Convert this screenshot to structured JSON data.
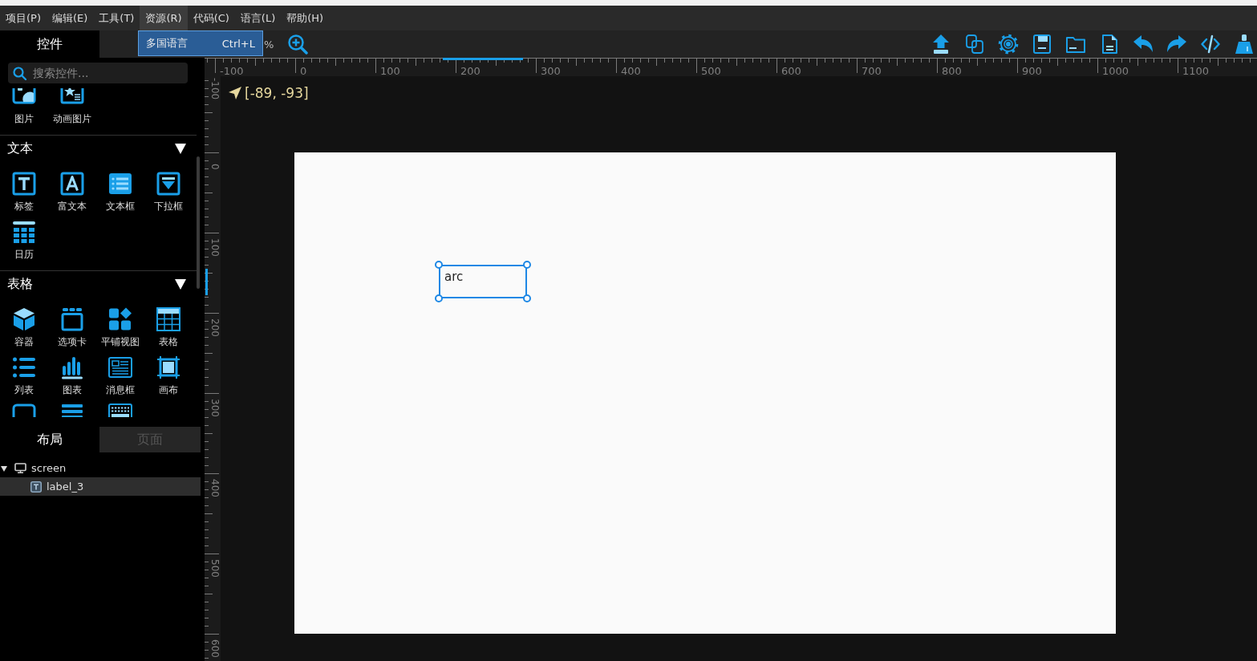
{
  "menu_bar": {
    "items": [
      {
        "label": "项目(P)",
        "selected": false
      },
      {
        "label": "编辑(E)",
        "selected": false
      },
      {
        "label": "工具(T)",
        "selected": false
      },
      {
        "label": "资源(R)",
        "selected": true
      },
      {
        "label": "代码(C)",
        "selected": false
      },
      {
        "label": "语言(L)",
        "selected": false
      },
      {
        "label": "帮助(H)",
        "selected": false
      }
    ]
  },
  "menu_dropdown": {
    "items": [
      {
        "label": "多国语言",
        "shortcut": "Ctrl+L",
        "selected": true
      }
    ]
  },
  "left_panel": {
    "top_tabs": [
      {
        "label": "控件",
        "selected": true
      }
    ],
    "search": {
      "placeholder": "搜索控件..."
    },
    "widget_groups": [
      {
        "items": [
          {
            "kind": "image",
            "label": "图片"
          },
          {
            "kind": "animimg",
            "label": "动画图片"
          }
        ]
      },
      {
        "title": "文本",
        "expanded": true,
        "items": [
          {
            "kind": "label",
            "label": "标签"
          },
          {
            "kind": "richtext",
            "label": "富文本"
          },
          {
            "kind": "textarea",
            "label": "文本框"
          },
          {
            "kind": "dropdown",
            "label": "下拉框"
          },
          {
            "kind": "calendar",
            "label": "日历"
          }
        ]
      },
      {
        "title": "表格",
        "expanded": true,
        "items": [
          {
            "kind": "container",
            "label": "容器"
          },
          {
            "kind": "tabview",
            "label": "选项卡"
          },
          {
            "kind": "tileview",
            "label": "平铺视图"
          },
          {
            "kind": "table",
            "label": "表格"
          },
          {
            "kind": "list",
            "label": "列表"
          },
          {
            "kind": "chart",
            "label": "图表"
          },
          {
            "kind": "msgbox",
            "label": "消息框"
          },
          {
            "kind": "canvas",
            "label": "画布"
          },
          {
            "kind": "frame"
          },
          {
            "kind": "bars"
          },
          {
            "kind": "keyboard"
          }
        ]
      }
    ],
    "bottom_tabs": [
      {
        "label": "布局",
        "selected": true
      },
      {
        "label": "页面",
        "selected": false
      }
    ],
    "tree": [
      {
        "kind": "screen",
        "label": "screen",
        "expanded": true,
        "selected": false,
        "children": [
          {
            "kind": "label",
            "label": "label_3",
            "selected": true
          }
        ]
      }
    ]
  },
  "toolbar": {
    "zoom_level": "%"
  },
  "rulers": {
    "horizontal": [
      "-100",
      "0",
      "100",
      "200",
      "300",
      "400",
      "500",
      "600",
      "700",
      "800",
      "900",
      "1000",
      "1100"
    ],
    "vertical": [
      "-100",
      "0",
      "100",
      "200",
      "300",
      "400",
      "500",
      "600"
    ]
  },
  "canvas": {
    "cursor_position": "[-89, -93]",
    "widgets": [
      {
        "kind": "label",
        "text": "arc",
        "selected": true
      }
    ]
  }
}
